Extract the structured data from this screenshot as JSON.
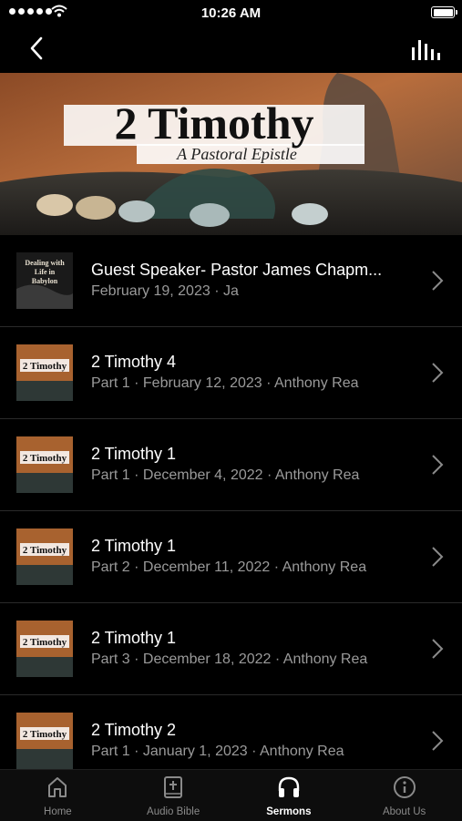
{
  "status_bar": {
    "time": "10:26 AM"
  },
  "banner": {
    "title": "2 Timothy",
    "subtitle": "A Pastoral Epistle"
  },
  "thumbnails": {
    "guest": {
      "line1": "Dealing with",
      "line2": "Life in",
      "line3": "Babylon"
    },
    "series": {
      "text": "2 Timothy"
    }
  },
  "sermons": [
    {
      "title": "Guest Speaker- Pastor James Chapm...",
      "subtitle": "February 19, 2023 · Ja"
    },
    {
      "title": "2 Timothy 4",
      "subtitle": "Part 1 · February 12, 2023 · Anthony Rea"
    },
    {
      "title": "2 Timothy 1",
      "subtitle": "Part 1 · December 4, 2022 · Anthony Rea"
    },
    {
      "title": "2 Timothy 1",
      "subtitle": "Part 2 · December 11, 2022 · Anthony Rea"
    },
    {
      "title": "2 Timothy 1",
      "subtitle": "Part 3 · December 18, 2022 · Anthony Rea"
    },
    {
      "title": "2 Timothy 2",
      "subtitle": "Part 1 · January 1, 2023 · Anthony Rea"
    }
  ],
  "tabs": [
    {
      "label": "Home",
      "icon": "home-icon",
      "active": false
    },
    {
      "label": "Audio Bible",
      "icon": "bible-icon",
      "active": false
    },
    {
      "label": "Sermons",
      "icon": "headphones-icon",
      "active": true
    },
    {
      "label": "About Us",
      "icon": "info-icon",
      "active": false
    }
  ],
  "colors": {
    "background": "#000000",
    "subtitle_text": "#9a9a9a",
    "inactive_tab": "#8a8a8a",
    "active_tab": "#ffffff"
  }
}
